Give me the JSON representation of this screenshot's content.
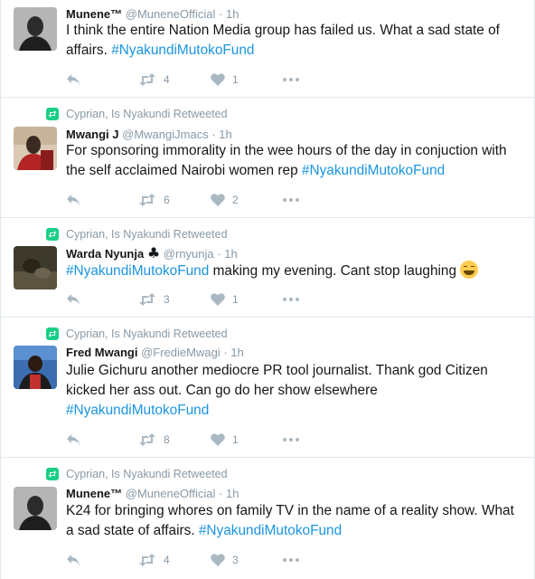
{
  "tweets": [
    {
      "retweeted_by": "",
      "name": "Munene™",
      "handle": "@MuneneOfficial",
      "time": "1h",
      "text": "I think the entire Nation Media group has failed us. What a sad state of affairs.",
      "hashtag": "#NyakundiMutokoFund",
      "retweets": "4",
      "likes": "1"
    },
    {
      "retweeted_by": "Cyprian, Is Nyakundi Retweeted",
      "name": "Mwangi J",
      "handle": "@MwangiJmacs",
      "time": "1h",
      "text": "For sponsoring immorality in the wee hours of the day in conjuction with the self acclaimed Nairobi women rep",
      "hashtag": "#NyakundiMutokoFund",
      "retweets": "6",
      "likes": "2"
    },
    {
      "retweeted_by": "Cyprian, Is Nyakundi Retweeted",
      "name": "Warda Nyunja",
      "name_suffix": "♣",
      "handle": "@rnyunja",
      "time": "1h",
      "hashtag": "#NyakundiMutokoFund",
      "text": "making my evening. Cant stop laughing",
      "retweets": "3",
      "likes": "1"
    },
    {
      "retweeted_by": "Cyprian, Is Nyakundi Retweeted",
      "name": "Fred Mwangi",
      "handle": "@FredieMwagi",
      "time": "1h",
      "text": "Julie Gichuru another mediocre PR tool journalist. Thank god Citizen kicked her ass out. Can go do her show elsewhere",
      "hashtag": "#NyakundiMutokoFund",
      "retweets": "8",
      "likes": "1"
    },
    {
      "retweeted_by": "Cyprian, Is Nyakundi Retweeted",
      "name": "Munene™",
      "handle": "@MuneneOfficial",
      "time": "1h",
      "text": "K24 for bringing whores on family TV in the name of a reality show. What a sad state of affairs.",
      "hashtag": "#NyakundiMutokoFund",
      "retweets": "4",
      "likes": "3"
    }
  ],
  "separator": "·",
  "icons": {
    "reply": "reply-icon",
    "retweet": "retweet-icon",
    "like": "heart-icon",
    "more": "more-icon",
    "retweeted": "retweeted-icon"
  },
  "colors": {
    "hashtag": "#1b95e0",
    "muted": "#8899a6",
    "retweet_green": "#19cf86"
  }
}
